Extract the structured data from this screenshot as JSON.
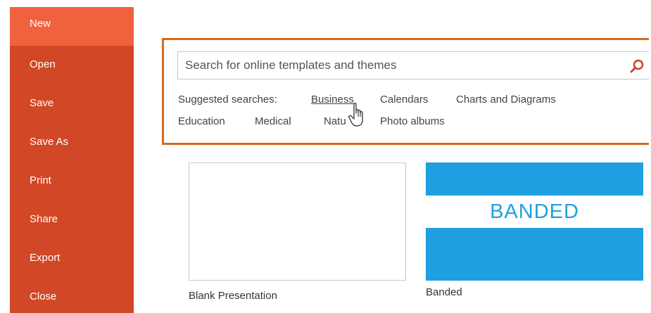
{
  "sidebar": {
    "items": [
      {
        "label": "New",
        "active": true
      },
      {
        "label": "Open"
      },
      {
        "label": "Save"
      },
      {
        "label": "Save As"
      },
      {
        "label": "Print"
      },
      {
        "label": "Share"
      },
      {
        "label": "Export"
      },
      {
        "label": "Close"
      }
    ],
    "colors": {
      "background": "#d24726",
      "active": "#f0623d"
    }
  },
  "search": {
    "placeholder": "Search for online templates and themes",
    "value": "",
    "icon": "search-icon",
    "highlight_color": "#d56b1e"
  },
  "suggested": {
    "label": "Suggested searches:",
    "links": [
      "Business",
      "Calendars",
      "Charts and Diagrams",
      "Education",
      "Medical",
      "Natu",
      "Photo albums"
    ]
  },
  "templates": [
    {
      "label": "Blank Presentation",
      "kind": "blank"
    },
    {
      "label": "Banded",
      "kind": "banded",
      "thumb_title": "BANDED",
      "thumb_subtitle": "",
      "accent": "#1fa0e0"
    }
  ],
  "cursor": "hand-pointer-icon"
}
